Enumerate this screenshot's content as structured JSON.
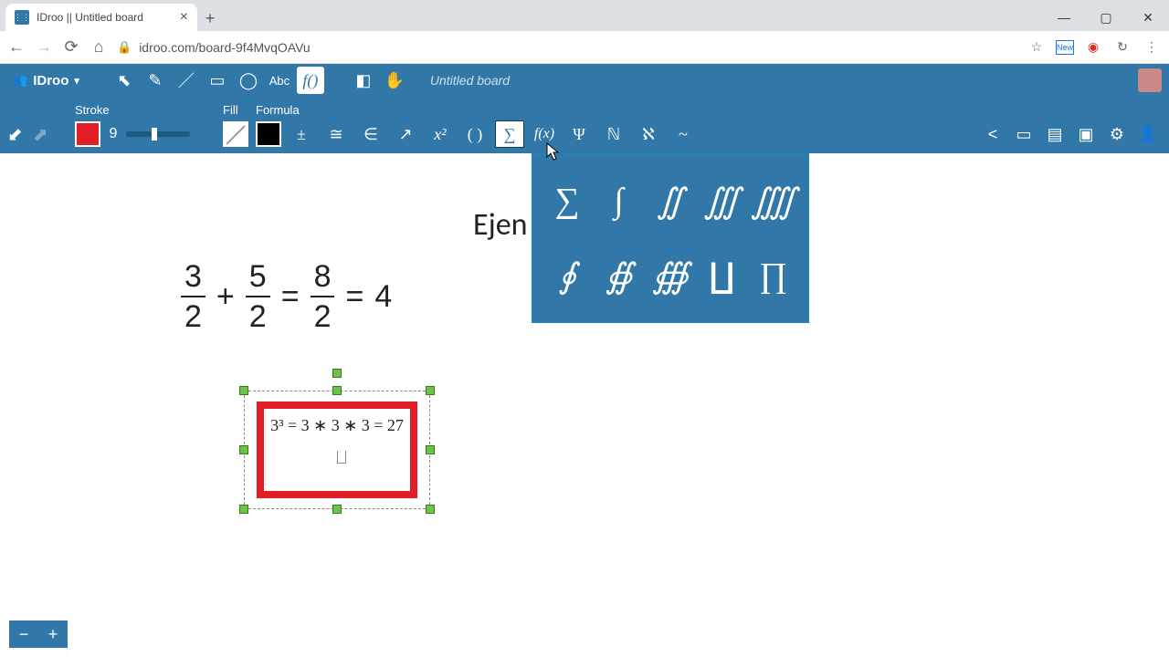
{
  "browser": {
    "tab_title": "IDroo || Untitled board",
    "url": "idroo.com/board-9f4MvqOAVu",
    "favicon_text": "⋮⋮"
  },
  "window": {
    "min": "—",
    "max": "▢",
    "close": "✕"
  },
  "nav": {
    "back": "←",
    "fwd": "→",
    "reload": "⟳",
    "home": "⌂",
    "lock": "🔒",
    "star": "☆",
    "menu": "⋮"
  },
  "app": {
    "brand": "IDroo",
    "board_name": "Untitled board"
  },
  "tools": {
    "select": "⬉",
    "pencil": "✎",
    "line": "／",
    "rect": "▭",
    "ellipse": "◯",
    "text": "Abc",
    "formula": "f()",
    "eraser": "◧",
    "pan": "✋"
  },
  "sub": {
    "stroke_label": "Stroke",
    "fill_label": "Fill",
    "formula_label": "Formula",
    "stroke_value": "9",
    "fbtns": {
      "pm": "±",
      "cong": "≅",
      "in": "∈",
      "arrow": "↗",
      "x2": "x²",
      "paren": "( )",
      "sigma": "∑",
      "fx": "f(x)",
      "psi": "Ψ",
      "nat": "ℕ",
      "aleph": "ℵ",
      "tilde": "~"
    }
  },
  "right": {
    "share": "<",
    "chat": "▭",
    "doc": "▤",
    "image": "▣",
    "settings": "⚙",
    "user": "👤"
  },
  "panel": {
    "sum": "∑",
    "int1": "∫",
    "int2": "∬",
    "int3": "∭",
    "int4": "⨌",
    "oint1": "∮",
    "oint2": "∯",
    "oint3": "∰",
    "coprod": "∐",
    "prod": "∏"
  },
  "canvas": {
    "ejen": "Ejen",
    "frac1_num": "3",
    "frac1_den": "2",
    "plus": "+",
    "frac2_num": "5",
    "frac2_den": "2",
    "eq": "=",
    "frac3_num": "8",
    "frac3_den": "2",
    "four": "4",
    "eqn2": "3³ = 3 ∗ 3 ∗ 3 = 27"
  },
  "zoom": {
    "out": "−",
    "in": "+"
  }
}
